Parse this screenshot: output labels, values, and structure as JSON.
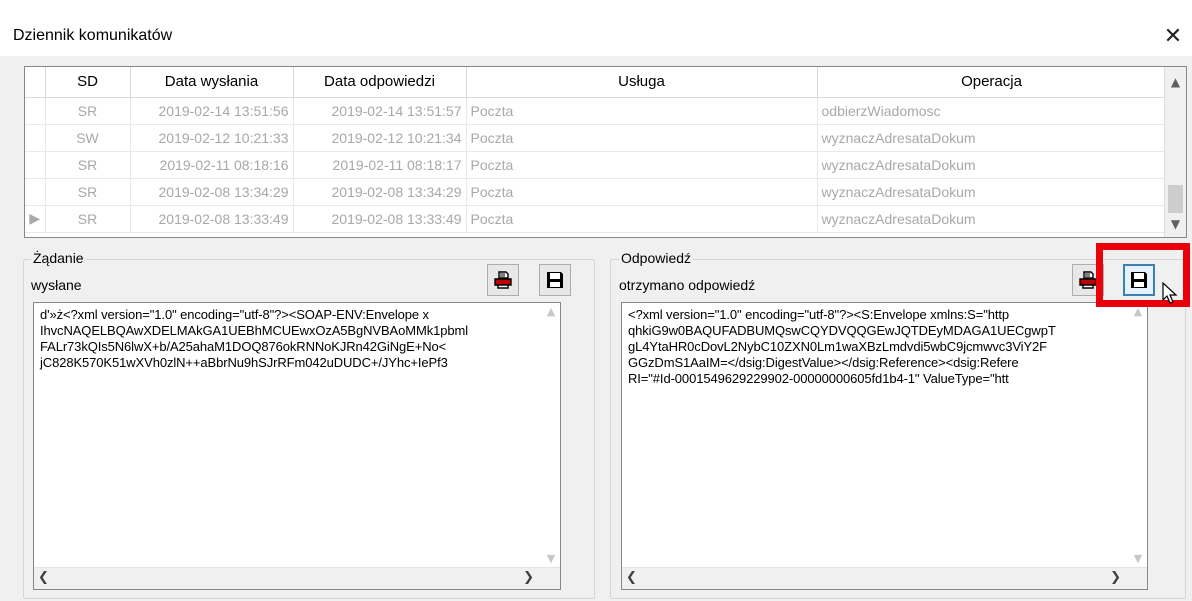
{
  "window": {
    "title": "Dziennik komunikatów",
    "close_glyph": "✕"
  },
  "grid": {
    "columns": [
      "SD",
      "Data wysłania",
      "Data odpowiedzi",
      "Usługa",
      "Operacja"
    ],
    "rows": [
      {
        "sd": "SR",
        "sent": "2019-02-14 13:51:56",
        "reply": "2019-02-14 13:51:57",
        "service": "Poczta",
        "operation": "odbierzWiadomosc",
        "current": false
      },
      {
        "sd": "SW",
        "sent": "2019-02-12 10:21:33",
        "reply": "2019-02-12 10:21:34",
        "service": "Poczta",
        "operation": "wyznaczAdresataDokum",
        "current": false
      },
      {
        "sd": "SR",
        "sent": "2019-02-11 08:18:16",
        "reply": "2019-02-11 08:18:17",
        "service": "Poczta",
        "operation": "wyznaczAdresataDokum",
        "current": false
      },
      {
        "sd": "SR",
        "sent": "2019-02-08 13:34:29",
        "reply": "2019-02-08 13:34:29",
        "service": "Poczta",
        "operation": "wyznaczAdresataDokum",
        "current": false
      },
      {
        "sd": "SR",
        "sent": "2019-02-08 13:33:49",
        "reply": "2019-02-08 13:33:49",
        "service": "Poczta",
        "operation": "wyznaczAdresataDokum",
        "current": true
      }
    ],
    "current_row_marker": "▶"
  },
  "request": {
    "title": "Żądanie",
    "subtitle": "wysłane",
    "text": "d'»ż<?xml version=\"1.0\" encoding=\"utf-8\"?><SOAP-ENV:Envelope x\nIhvcNAQELBQAwXDELMAkGA1UEBhMCUEwxOzA5BgNVBAoMMk1pbml\nFALr73kQIs5N6lwX+b/A25ahaM1DOQ876okRNNoKJRn42GiNgE+No<\njC828K570K51wXVh0zlN++aBbrNu9hSJrRFm042uDUDC+/JYhc+IePf3"
  },
  "response": {
    "title": "Odpowiedź",
    "subtitle": "otrzymano odpowiedź",
    "text": "<?xml version=\"1.0\" encoding=\"utf-8\"?><S:Envelope xmlns:S=\"http\nqhkiG9w0BAQUFADBUMQswCQYDVQQGEwJQTDEyMDAGA1UECgwpT\ngL4YtaHR0cDovL2NybC10ZXN0Lm1waXBzLmdvdi5wbC9jcmwvc3ViY2F\nGGzDmS1AaIM=</dsig:DigestValue></dsig:Reference><dsig:Refere\nRI=\"#Id-0001549629229902-00000000605fd1b4-1\" ValueType=\"htt"
  },
  "icons": {
    "print": "print-icon",
    "save": "save-icon"
  },
  "colors": {
    "highlight": "#e8000b",
    "link_blue": "#0000c8",
    "dim_text": "#a8a8a8"
  }
}
